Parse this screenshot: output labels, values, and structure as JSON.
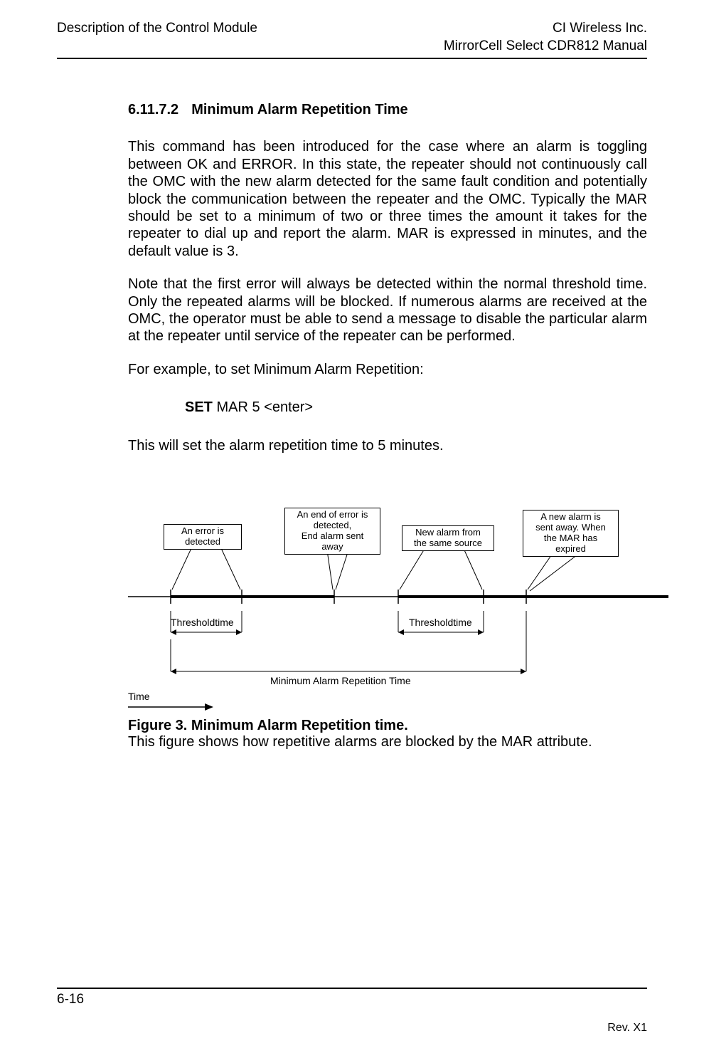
{
  "header": {
    "left": "Description of the Control Module",
    "right_line1": "CI Wireless Inc.",
    "right_line2": "MirrorCell Select CDR812 Manual"
  },
  "section": {
    "number": "6.11.7.2",
    "title": "Minimum Alarm Repetition Time"
  },
  "paragraphs": {
    "p1": "This command has been introduced for the case where an alarm is toggling between OK and ERROR. In this state, the repeater should not continuously call the OMC with the new alarm detected for the same fault condition and potentially block the communication between the repeater and the OMC. Typically the MAR should be set to a minimum of two or three times the amount it takes for the repeater to dial up and report the alarm. MAR is expressed in minutes, and the default value is 3.",
    "p2": "Note that the first error will always be detected within the normal threshold time. Only the repeated alarms will be blocked. If numerous alarms are received at the OMC, the operator must be able to send a message to disable the particular alarm at the repeater until service of the repeater can be performed.",
    "p3": "For example, to set Minimum Alarm Repetition:",
    "p4": "This will set the alarm repetition time to 5 minutes."
  },
  "command": {
    "set": "SET",
    "args": " MAR 5 <enter>"
  },
  "figure": {
    "box1": "An error is\ndetected",
    "box2": "An end of error is\ndetected,\nEnd alarm sent\naway",
    "box3": "New alarm from\nthe same source",
    "box4": "A new alarm is\nsent away. When\nthe MAR has\nexpired",
    "threshold1": "Thresholdtime",
    "threshold2": "Thresholdtime",
    "mar_label": "Minimum Alarm Repetition Time",
    "time_label": "Time",
    "caption_bold": "Figure 3. Minimum Alarm Repetition time.",
    "caption_body": "This figure shows how repetitive alarms are blocked by the MAR attribute."
  },
  "footer": {
    "left": "6-16",
    "right": "Rev. X1"
  }
}
